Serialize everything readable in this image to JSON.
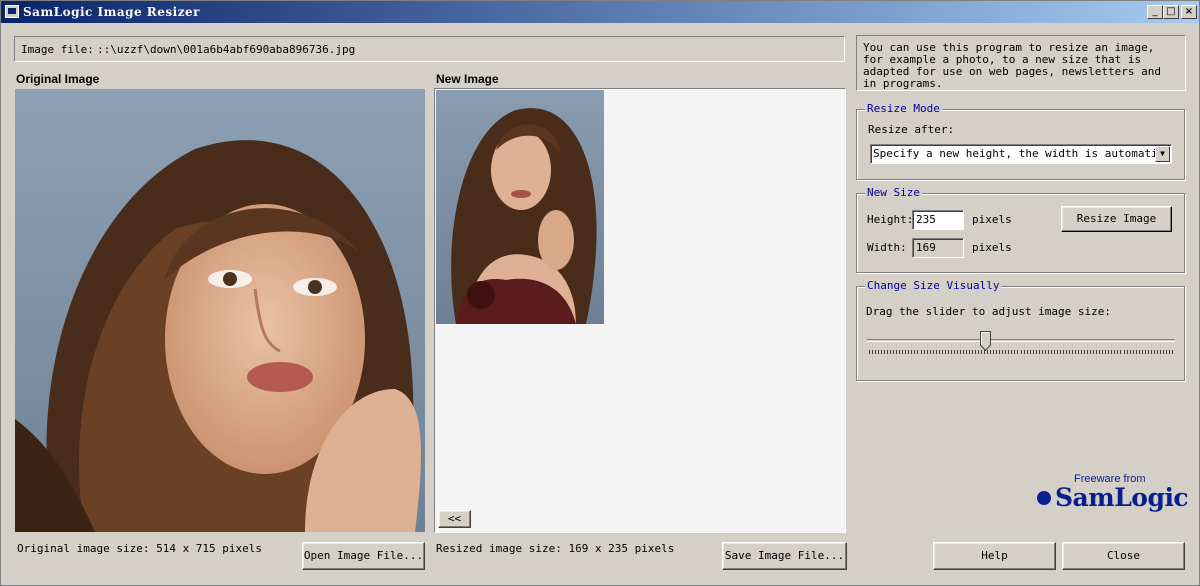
{
  "window": {
    "title": "SamLogic Image Resizer",
    "controls": {
      "minimize": "_",
      "maximize": "□",
      "close": "×"
    }
  },
  "file": {
    "label": "Image file:",
    "path": "::\\uzzf\\down\\001a6b4abf690aba896736.jpg"
  },
  "original": {
    "heading": "Original Image",
    "size_text": "Original image size: 514 x 715 pixels",
    "open_button": "Open Image File..."
  },
  "new_image": {
    "heading": "New Image",
    "size_text": "Resized image size: 169 x 235 pixels",
    "save_button": "Save Image File...",
    "back_button": "<<"
  },
  "info": {
    "text": "You can use this program to resize an image, for example a photo, to a new size that is adapted for use on web pages, newsletters and in programs."
  },
  "resize_mode": {
    "legend": "Resize Mode",
    "label": "Resize after:",
    "selected": "Specify a new height, the width is automatical"
  },
  "new_size": {
    "legend": "New Size",
    "height_label": "Height:",
    "height_value": "235",
    "height_unit": "pixels",
    "width_label": "Width:",
    "width_value": "169",
    "width_unit": "pixels",
    "resize_button": "Resize Image"
  },
  "visual": {
    "legend": "Change Size Visually",
    "label": "Drag the slider to adjust image size:",
    "slider_fraction": 0.38
  },
  "brand": {
    "freeware": "Freeware from",
    "name": "SamLogic",
    "color": "#0a1f8f"
  },
  "footer": {
    "help_button": "Help",
    "close_button": "Close"
  }
}
